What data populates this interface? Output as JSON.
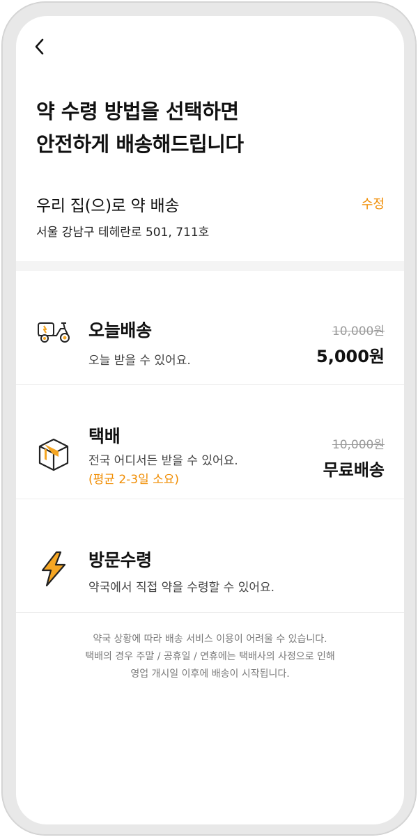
{
  "header": {
    "back_icon": "chevron-left-icon",
    "headline_line1": "약 수령 방법을 선택하면",
    "headline_line2": "안전하게 배송해드립니다"
  },
  "address": {
    "title": "우리 집(으)로 약 배송",
    "edit_label": "수정",
    "value": "서울 강남구 테헤란로 501, 711호"
  },
  "options": [
    {
      "icon": "scooter-icon",
      "title": "오늘배송",
      "desc": "오늘 받을 수 있어요.",
      "price_old": "10,000원",
      "price_new": "5,000원"
    },
    {
      "icon": "box-icon",
      "title": "택배",
      "desc": "전국 어디서든 받을 수 있어요.",
      "note": "(평균 2-3일 소요)",
      "price_old": "10,000원",
      "price_new": "무료배송"
    },
    {
      "icon": "lightning-icon",
      "title": "방문수령",
      "desc": "약국에서 직접 약을 수령할 수 있어요."
    }
  ],
  "footer": {
    "line1": "약국 상황에 따라 배송 서비스 이용이 어려울 수 있습니다.",
    "line2": "택배의 경우 주말 / 공휴일 / 연휴에는 택배사의 사정으로 인해",
    "line3": "영업 개시일 이후에 배송이 시작됩니다."
  },
  "colors": {
    "accent": "#f08c00",
    "text": "#111111",
    "muted": "#9a9a9a"
  }
}
